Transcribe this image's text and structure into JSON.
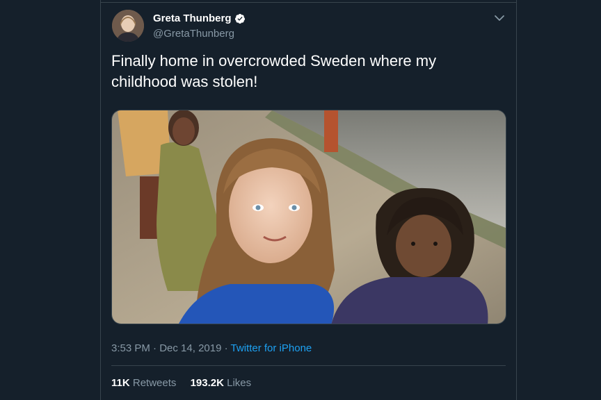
{
  "tweet": {
    "author": {
      "display_name": "Greta Thunberg",
      "handle": "@GretaThunberg",
      "verified": true
    },
    "text": "Finally home in overcrowded Sweden where my childhood was stolen!",
    "media": {
      "type": "photo",
      "icon": "photo"
    },
    "time": "3:53 PM",
    "separator": "·",
    "date": "Dec 14, 2019",
    "source": "Twitter for iPhone",
    "stats": {
      "retweets_count": "11K",
      "retweets_label": "Retweets",
      "likes_count": "193.2K",
      "likes_label": "Likes"
    }
  },
  "colors": {
    "background": "#15202b",
    "text_primary": "#ffffff",
    "text_secondary": "#8899a6",
    "link": "#1da1f2",
    "divider": "#38444d"
  }
}
